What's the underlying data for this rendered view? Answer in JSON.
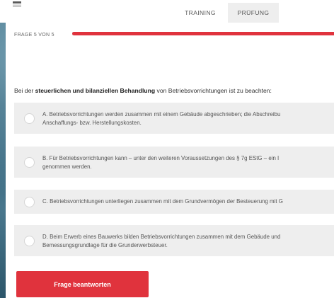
{
  "header": {
    "menu_icon": "hamburger-menu-icon",
    "tabs": [
      {
        "label": "TRAINING",
        "active": true
      },
      {
        "label": "PRÜFUNG",
        "active": false
      }
    ]
  },
  "progress": {
    "label": "FRAGE 5 VON 5",
    "current": 5,
    "total": 5,
    "fraction": 1.0
  },
  "question": {
    "prefix": "Bei der ",
    "bold": "steuerlichen und bilanziellen Behandlung",
    "suffix": " von Betriebsvorrichtungen ist zu beachten:"
  },
  "answers": [
    {
      "line1": "A. Betriebsvorrichtungen werden zusammen mit einem Gebäude abgeschrieben; die Abschreibu",
      "line2": "Anschaffungs- bzw. Herstellungskosten."
    },
    {
      "line1": "B. Für Betriebsvorrichtungen kann – unter den weiteren Voraussetzungen des § 7g EStG – ein I",
      "line2": "genommen werden."
    },
    {
      "line1": "C. Betriebsvorrichtungen unterliegen zusammen mit dem Grundvermögen der Besteuerung mit G",
      "line2": ""
    },
    {
      "line1": "D. Beim Erwerb eines Bauwerks bilden Betriebsvorrichtungen zusammen mit dem Gebäude und",
      "line2": "Bemessungsgrundlage für die Grunderwerbsteuer."
    }
  ],
  "submit": {
    "label": "Frage beantworten"
  },
  "colors": {
    "accent": "#e0333d",
    "answer_bg": "#eeeeee"
  }
}
